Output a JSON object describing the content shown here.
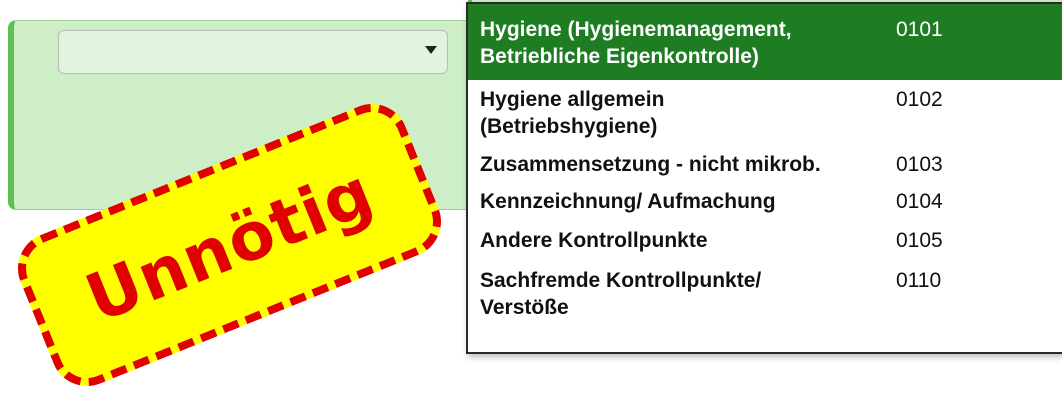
{
  "form": {
    "select_value": ""
  },
  "dropdown": {
    "options": [
      {
        "label_line1": "Hygiene (Hygienemanagement,",
        "label_line2": "Betriebliche Eigenkontrolle)",
        "code": "0101",
        "selected": true
      },
      {
        "label_line1": "Hygiene allgemein",
        "label_line2": "(Betriebshygiene)",
        "code": "0102",
        "selected": false
      },
      {
        "label_line1": "Zusammensetzung - nicht mikrob.",
        "label_line2": "",
        "code": "0103",
        "selected": false
      },
      {
        "label_line1": "Kennzeichnung/ Aufmachung",
        "label_line2": "",
        "code": "0104",
        "selected": false
      },
      {
        "label_line1": "Andere Kontrollpunkte",
        "label_line2": "",
        "code": "0105",
        "selected": false
      },
      {
        "label_line1": "Sachfremde Kontrollpunkte/",
        "label_line2": "Verstöße",
        "code": "0110",
        "selected": false
      }
    ]
  },
  "stamp": {
    "text": "Unnötig",
    "colors": {
      "fill": "#ffff00",
      "border": "#e00000",
      "text": "#e00000"
    }
  },
  "colors": {
    "panel_bg": "#cdeec6",
    "panel_accent": "#5fbf52",
    "selected_bg": "#1e7d23"
  }
}
